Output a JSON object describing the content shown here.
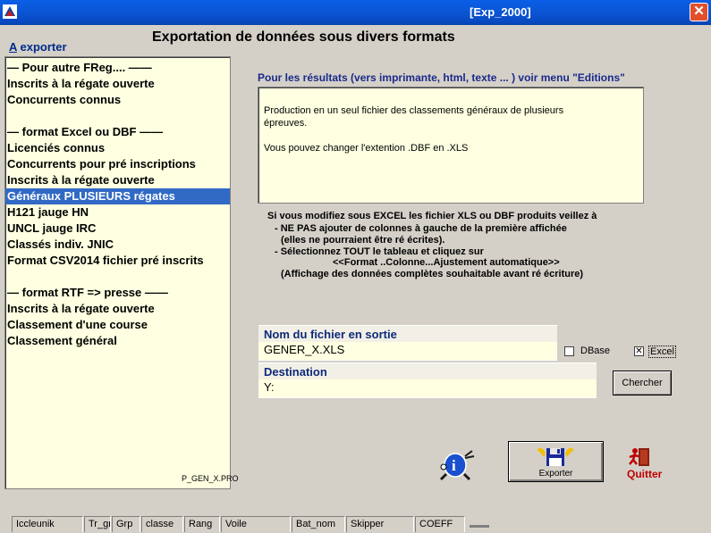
{
  "window": {
    "title": "[Exp_2000]",
    "close_glyph": "✕"
  },
  "page": {
    "heading": "Exportation de données sous divers formats",
    "export_label_prefix": "A",
    "export_label_rest": " exporter"
  },
  "list": {
    "items": [
      "— Pour autre FReg.... ——",
      "Inscrits à la régate ouverte",
      "Concurrents connus",
      "",
      "— format Excel ou DBF ——",
      "Licenciés connus",
      "Concurrents pour pré inscriptions",
      "Inscrits à la régate ouverte",
      "Généraux PLUSIEURS régates",
      "H121 jauge HN",
      "UNCL jauge IRC",
      "Classés indiv. JNIC",
      "Format CSV2014 fichier pré inscrits",
      "",
      "— format RTF => presse ——",
      "Inscrits à la régate ouverte",
      "Classement d'une course",
      "Classement général"
    ],
    "selected_index": 8
  },
  "info": {
    "heading": "Pour les résultats (vers imprimante, html, texte ... ) voir menu \"Editions\"",
    "desc_line1": "Production en un seul fichier des classements généraux de plusieurs",
    "desc_line2": "épreuves.",
    "desc_line3": "Vous pouvez changer l'extention .DBF en .XLS"
  },
  "warning": {
    "line1": "Si vous modifiez sous EXCEL les fichier XLS ou DBF produits veillez à",
    "line2": "- NE PAS ajouter de colonnes à gauche de la première affichée",
    "line3": "(elles ne pourraient être ré écrites).",
    "line4": "- Sélectionnez TOUT le tableau et cliquez sur",
    "line5": "<<Format ..Colonne...Ajustement automatique>>",
    "line6": "(Affichage des données complètes souhaitable avant ré écriture)"
  },
  "output": {
    "filename_label": "Nom du fichier en sortie",
    "filename_value": "GENER_X.XLS",
    "destination_label": "Destination",
    "destination_value": "Y:",
    "dbase_label": "DBase",
    "dbase_checked": false,
    "excel_label": "Excel",
    "excel_checked": true,
    "check_mark": "✕",
    "chercher_label": "Chercher"
  },
  "actions": {
    "exporter_label": "Exporter",
    "quit_label": "Quitter"
  },
  "program_name": "P_GEN_X.PRO",
  "statusbar": {
    "cells": [
      "Iccleunik",
      "Tr_gr",
      "Grp",
      "classe",
      "Rang",
      "Voile",
      "Bat_nom",
      "Skipper",
      "COEFF"
    ]
  },
  "colors": {
    "titlebar": "#0b56d6",
    "panel_bg": "#ffffe1",
    "selection": "#316ac5",
    "heading_blue": "#0d2a7a",
    "quit_red": "#c00000"
  }
}
